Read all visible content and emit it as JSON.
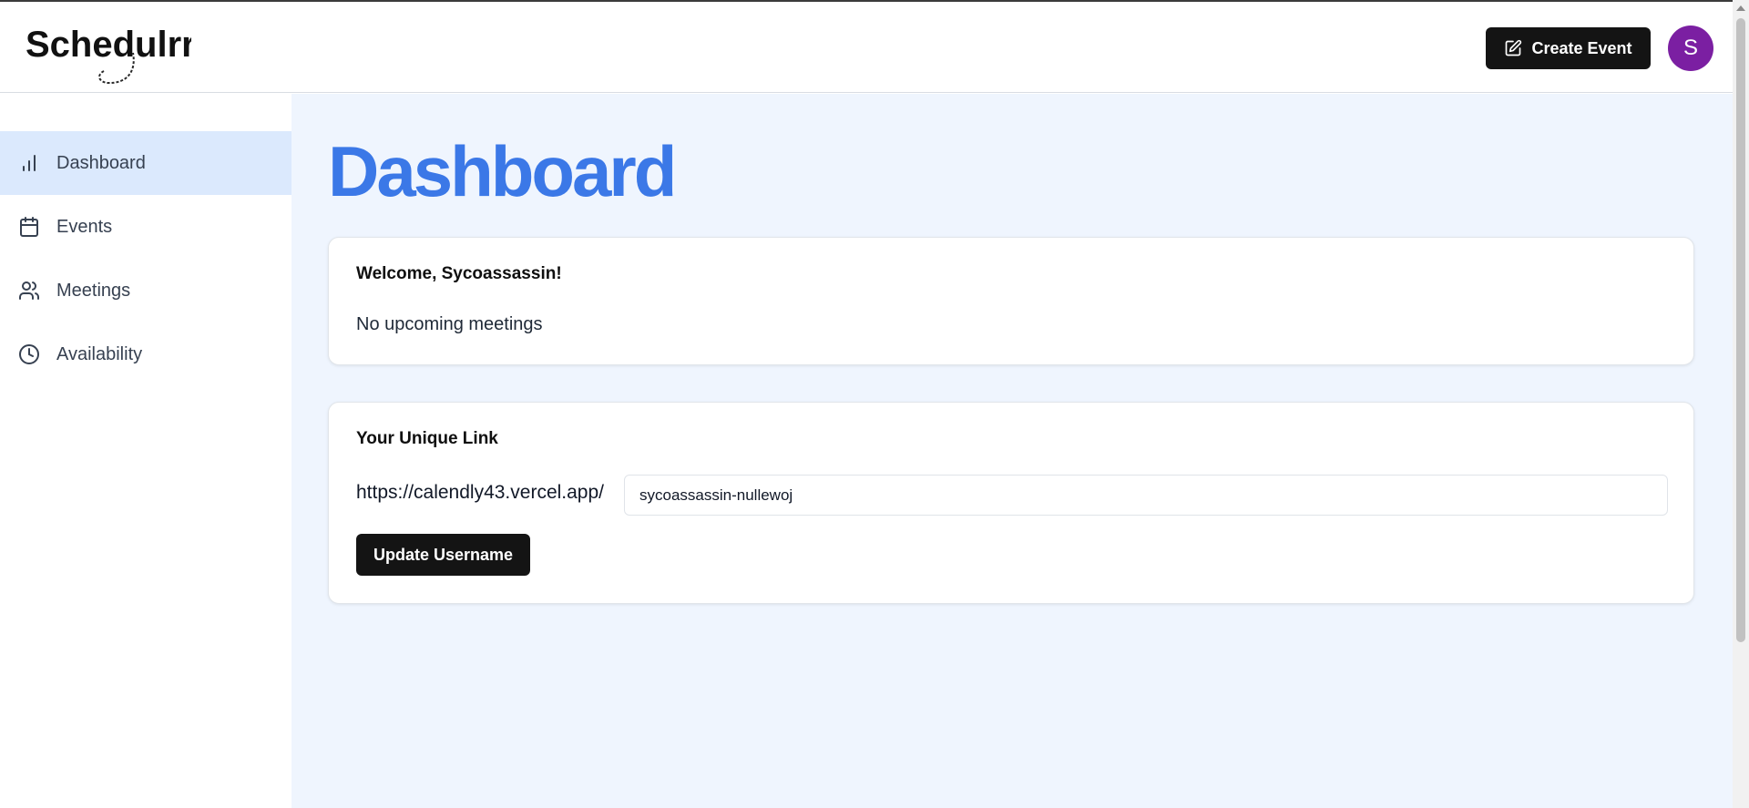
{
  "header": {
    "logo_text": "Schedulrr",
    "create_event_label": "Create Event",
    "avatar_initial": "S"
  },
  "sidebar": {
    "items": [
      {
        "label": "Dashboard",
        "icon": "bar-chart-icon",
        "active": true
      },
      {
        "label": "Events",
        "icon": "calendar-icon",
        "active": false
      },
      {
        "label": "Meetings",
        "icon": "users-icon",
        "active": false
      },
      {
        "label": "Availability",
        "icon": "clock-icon",
        "active": false
      }
    ]
  },
  "main": {
    "title": "Dashboard",
    "welcome_card": {
      "title": "Welcome, Sycoassassin!",
      "text": "No upcoming meetings"
    },
    "link_card": {
      "title": "Your Unique Link",
      "prefix": "https://calendly43.vercel.app/",
      "username_value": "sycoassassin-nullewoj",
      "update_button_label": "Update Username"
    }
  },
  "colors": {
    "accent": "#3b78e7",
    "sidebar_active_bg": "#dbe9fd",
    "main_bg": "#eff5fe",
    "avatar_bg": "#7b1fa2",
    "button_bg": "#141414"
  }
}
